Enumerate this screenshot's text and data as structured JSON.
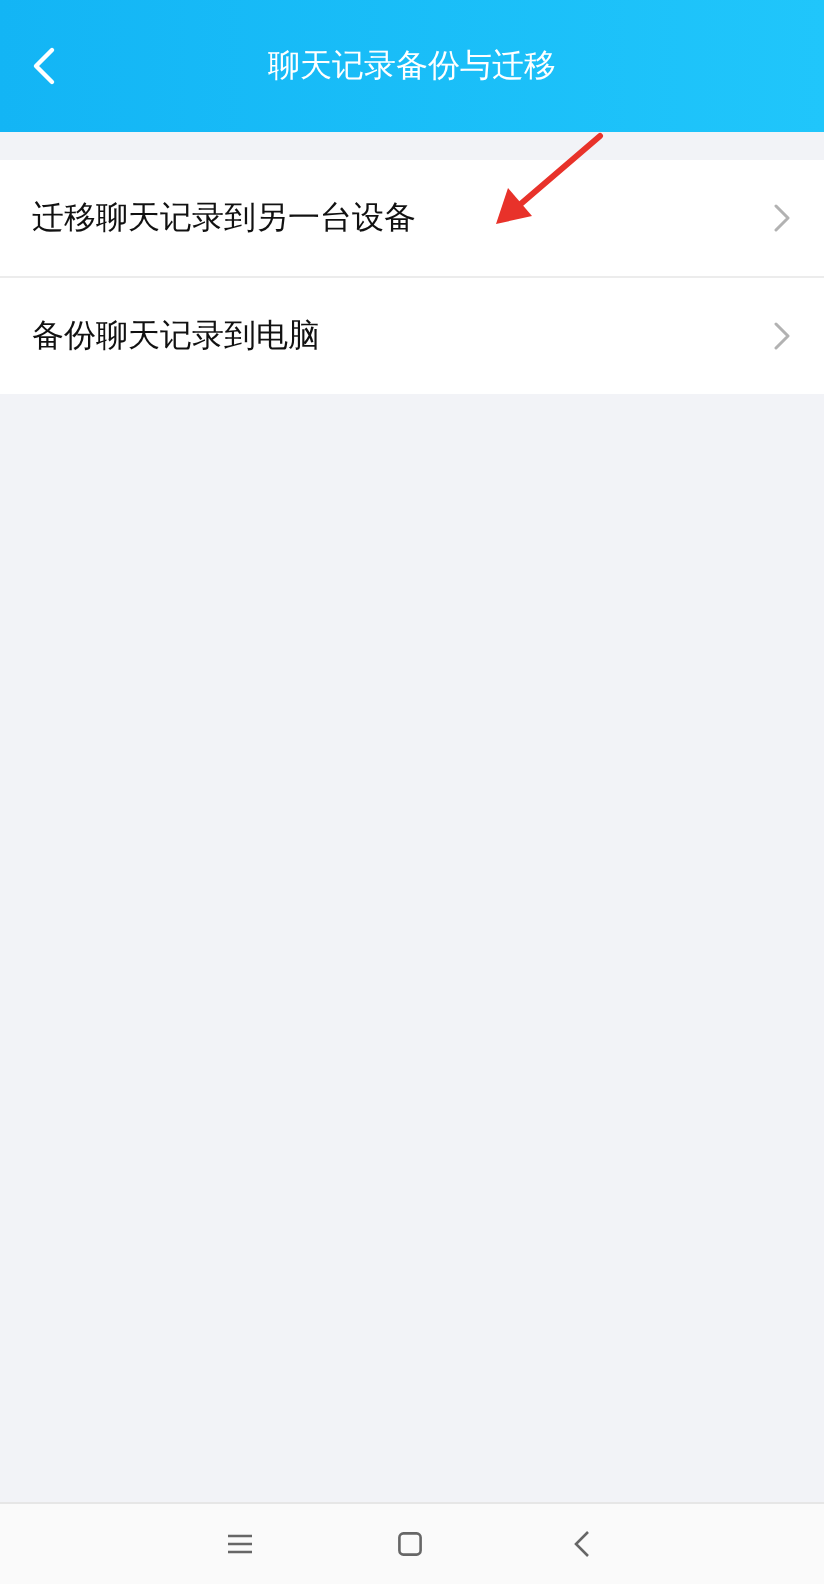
{
  "header": {
    "title": "聊天记录备份与迁移"
  },
  "menu_items": [
    {
      "label": "迁移聊天记录到另一台设备"
    },
    {
      "label": "备份聊天记录到电脑"
    }
  ]
}
